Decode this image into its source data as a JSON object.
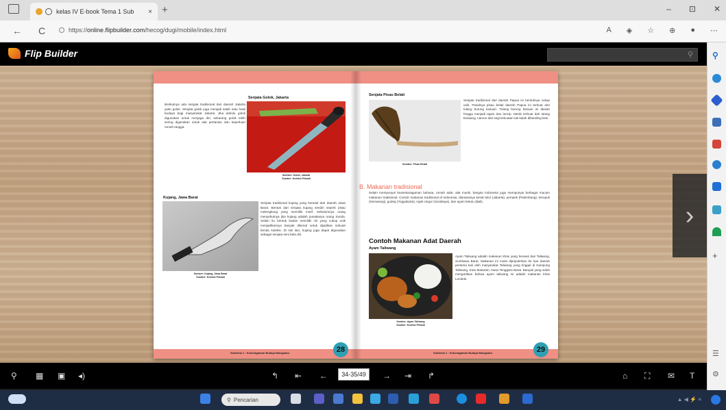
{
  "browser": {
    "tab_title": "kelas IV E-book Tema 1 Sub",
    "tab_close": "×",
    "new_tab": "+",
    "url_prefix": "https://",
    "url_host": "online.flipbuilder.com",
    "url_path": "/hecog/dugi/mobile/index.html",
    "back": "←",
    "refresh": "C",
    "minimize": "–",
    "restore": "⊡",
    "close": "✕"
  },
  "app": {
    "name": "Flip Builder",
    "search_placeholder": ""
  },
  "left_page": {
    "heading_1": "Senjata Golok, Jakarta",
    "para_1": "Berikutnya ada senjata tradisional dari daerah Jakarta yaitu golok. Senjata golok juga menjadi salah satu hasil budaya bagi masyarakat Jakarta. Jika dahulu golok digunakan untuk menjaga diri, sekarang golok lebih sering digunakan untuk alat pertanian dan keperluan rumah tangga.",
    "caption_1a": "Sumber: Golok, Jakarta",
    "caption_1b": "Sumber: Koleksi Pribadi",
    "heading_2": "Kujang, Jawa Barat",
    "para_2": "Senjata tradisional kujang yang berasal dari daerah Jawa Barat. Bentuk dari senjata kujang sendiri seperti pisau melengkung yang memiliki motif. Sebelumnya orang menyebutnya jika kujang adalah pusakanya orang Sunda. Selain itu bentuk badan memiliki ciri yang cukup unik menjadikannya banyak dikenal untuk dijadikan sebuah benda koleksi. Di sisi lain, kujang juga dapat digunakan sebagai senjata seni bela diri.",
    "caption_2a": "Sumber: Kujang, Jawa Barat",
    "caption_2b": "Sumber: Koleksi Pribadi",
    "footer": "Subtema 1 : Keberagaman Budaya Bangsaku",
    "page_number": "28"
  },
  "right_page": {
    "heading_1": "Senjata Pisau Belati",
    "para_1": "Senjata tradisional dari daerah Papua ini bentuknya cukup unik. Pasalnya pisau belati daerah Papua ini terbuat dari tulang burung kasuari. Tulang burung kasuari ini diasah hingga menjadi tajam dan lancip. Meski terbuat dari tulang binatang, namun dari segi kekuatan tak kalah dibanding besi.",
    "caption_1": "Sumber: Pisau Belati",
    "section_title": "B. Makanan tradisional",
    "section_para": "Selain mempunyai keanekaragaman bahasa, rumah adat, alat musik, bangsa Indonesia juga mempunyai berbagai macam makanan tradisional. Contoh makanan tradisional di Indonesia, diantaranya kerak telor (Jakarta), pempek (Palembang), kerupuk (Semarang), gudeg (Yogyakarta), rujak cingur (Surabaya), dan ayam betutu (Bali).",
    "sub_heading": "Contoh Makanan Adat Daerah",
    "sub_sub_heading": "Ayam Taliwang",
    "para_2": "Ayam Taliwang adalah makanan khas yang berasal dari Taliwang, Sumbawa Barat. Makanan ini mulai dipopulerkan ke luar daerah pertama kali oleh masyarakat Taliwang yang tinggal di Kampung Taliwang, Kota Mataram, Nusa Tenggara Barat. Banyak yang salah mengartikan bahwa ayam taliwang ini adalah makanan khas Lombok.",
    "caption_2a": "Sumber: Ayam Taliwang",
    "caption_2b": "Sumber: Koleksi Pribadi",
    "footer": "Subtema 1 : Keberagaman Budaya Bangsaku",
    "page_number": "29"
  },
  "toolbar": {
    "page_indicator": "34-35/49"
  },
  "taskbar": {
    "search_label": "Pencarian"
  }
}
